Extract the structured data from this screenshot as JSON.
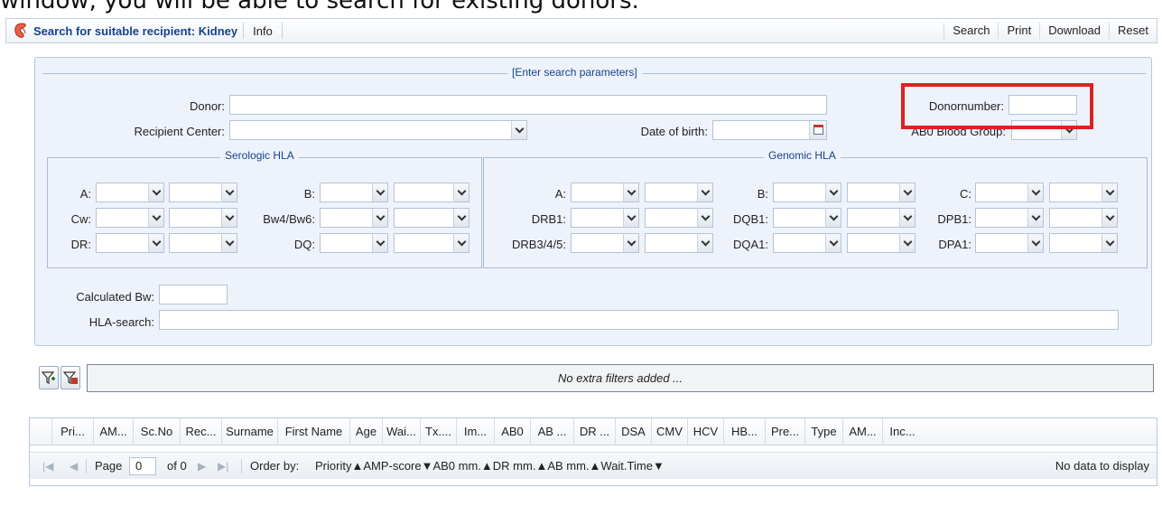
{
  "caption": "window, you will be able to search for existing donors.",
  "toolbar": {
    "title": "Search for suitable recipient: Kidney",
    "info": "Info",
    "search": "Search",
    "print": "Print",
    "download": "Download",
    "reset": "Reset"
  },
  "form": {
    "legend": "[Enter search parameters]",
    "donor_label": "Donor:",
    "donor_value": "",
    "donornumber_label": "Donornumber:",
    "donornumber_value": "",
    "recipient_center_label": "Recipient Center:",
    "recipient_center_value": "",
    "dob_label": "Date of birth:",
    "dob_value": "",
    "abo_label": "AB0 Blood Group:",
    "abo_value": "",
    "calculated_bw_label": "Calculated Bw:",
    "calculated_bw_value": "",
    "hla_search_label": "HLA-search:",
    "hla_search_value": ""
  },
  "serologic": {
    "legend": "Serologic HLA",
    "rows": [
      {
        "left": "A:",
        "right": "B:"
      },
      {
        "left": "Cw:",
        "right": "Bw4/Bw6:"
      },
      {
        "left": "DR:",
        "right": "DQ:"
      }
    ]
  },
  "genomic": {
    "legend": "Genomic HLA",
    "rows": [
      {
        "c1": "A:",
        "c2": "B:",
        "c3": "C:"
      },
      {
        "c1": "DRB1:",
        "c2": "DQB1:",
        "c3": "DPB1:"
      },
      {
        "c1": "DRB3/4/5:",
        "c2": "DQA1:",
        "c3": "DPA1:"
      }
    ]
  },
  "filters": {
    "empty_text": "No extra filters added ..."
  },
  "grid": {
    "columns": [
      "Pri...",
      "AM...",
      "Sc.No",
      "Rec...",
      "Surname",
      "First Name",
      "Age",
      "Wai...",
      "Tx....",
      "Im...",
      "AB0",
      "AB ...",
      "DR ...",
      "DSA",
      "CMV",
      "HCV",
      "HB...",
      "Pre...",
      "Type",
      "AM...",
      "Inc..."
    ],
    "page_label": "Page",
    "page_value": "0",
    "of_label": "of 0",
    "order_by_label": "Order by:",
    "order_by_value": "Priority▲AMP-score▼AB0 mm.▲DR mm.▲AB mm.▲Wait.Time▼",
    "no_data": "No data to display"
  },
  "colors": {
    "accent": "#15428b",
    "highlight_box": "#e02020",
    "panel_bg": "#eef3fb"
  }
}
